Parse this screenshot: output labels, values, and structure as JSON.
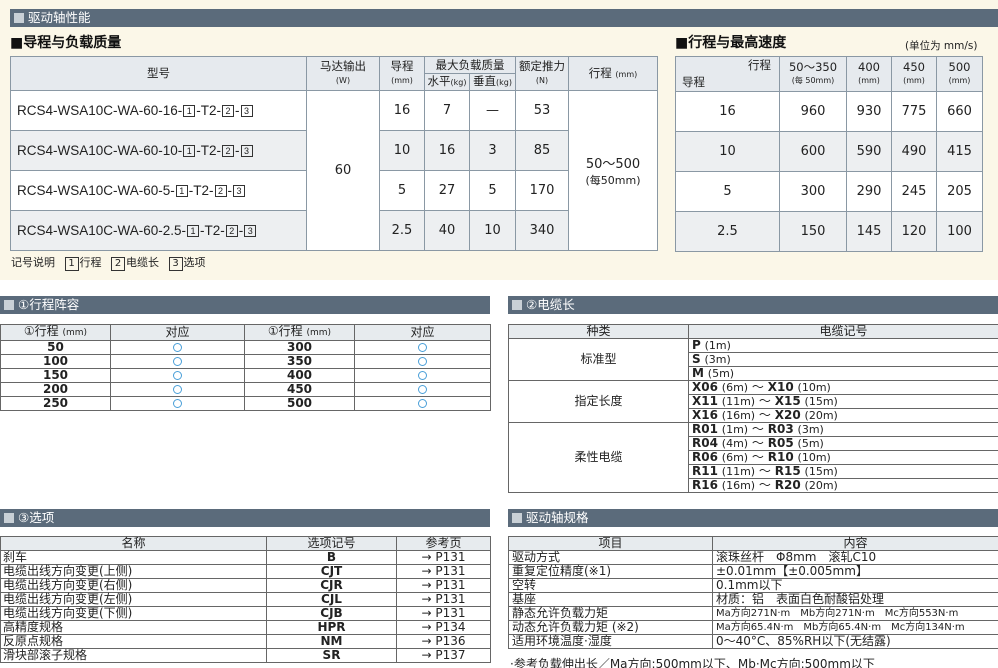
{
  "section_main": "驱动轴性能",
  "lead_load": {
    "heading": "■导程与负载质量",
    "headers": {
      "model": "型号",
      "motor": "马达输出",
      "motor_unit": "(W)",
      "lead": "导程",
      "lead_unit": "(mm)",
      "max_load": "最大负载质量",
      "horizontal": "水平",
      "horizontal_unit": "(kg)",
      "vertical": "垂直",
      "vertical_unit": "(kg)",
      "thrust": "额定推力",
      "thrust_unit": "(N)",
      "stroke": "行程",
      "stroke_unit": "(mm)"
    },
    "motor_value": "60",
    "stroke_value": "50～500",
    "stroke_step": "(每50mm)",
    "model_suffix": "-T2-",
    "model_sep": "-",
    "box1": "1",
    "box2": "2",
    "box3": "3",
    "rows": [
      {
        "model": "RCS4-WSA10C-WA-60-16-",
        "lead": "16",
        "horizontal": "7",
        "vertical": "—",
        "thrust": "53"
      },
      {
        "model": "RCS4-WSA10C-WA-60-10-",
        "lead": "10",
        "horizontal": "16",
        "vertical": "3",
        "thrust": "85"
      },
      {
        "model": "RCS4-WSA10C-WA-60-5-",
        "lead": "5",
        "horizontal": "27",
        "vertical": "5",
        "thrust": "170"
      },
      {
        "model": "RCS4-WSA10C-WA-60-2.5-",
        "lead": "2.5",
        "horizontal": "40",
        "vertical": "10",
        "thrust": "340"
      }
    ]
  },
  "speed": {
    "heading": "■行程与最高速度",
    "unit": "(单位为 mm/s)",
    "corner_top": "行程",
    "corner_bottom": "导程",
    "columns": [
      {
        "label": "50～350",
        "sub": "(每 50mm)"
      },
      {
        "label": "400",
        "sub": "(mm)"
      },
      {
        "label": "450",
        "sub": "(mm)"
      },
      {
        "label": "500",
        "sub": "(mm)"
      }
    ],
    "rows": [
      {
        "lead": "16",
        "values": [
          "960",
          "930",
          "775",
          "660"
        ]
      },
      {
        "lead": "10",
        "values": [
          "600",
          "590",
          "490",
          "415"
        ]
      },
      {
        "lead": "5",
        "values": [
          "300",
          "290",
          "245",
          "205"
        ]
      },
      {
        "lead": "2.5",
        "values": [
          "150",
          "145",
          "120",
          "100"
        ]
      }
    ]
  },
  "legend": {
    "label": "记号说明",
    "items": [
      {
        "box": "1",
        "text": "行程"
      },
      {
        "box": "2",
        "text": "电缆长"
      },
      {
        "box": "3",
        "text": "选项"
      }
    ]
  },
  "stroke_table": {
    "title": "①行程阵容",
    "headers": [
      "①行程",
      "(mm)",
      "对应",
      "①行程",
      "(mm)",
      "对应"
    ],
    "left": [
      "50",
      "100",
      "150",
      "200",
      "250"
    ],
    "right": [
      "300",
      "350",
      "400",
      "450",
      "500"
    ]
  },
  "cable_table": {
    "title": "②电缆长",
    "headers": [
      "种类",
      "电缆记号"
    ],
    "groups": [
      {
        "kind": "标准型",
        "lines": [
          {
            "code": "P",
            "len": "(1m)"
          },
          {
            "code": "S",
            "len": "(3m)"
          },
          {
            "code": "M",
            "len": "(5m)"
          }
        ]
      },
      {
        "kind": "指定长度",
        "lines": [
          {
            "code": "X06",
            "len": "(6m)",
            "code2": "X10",
            "len2": "(10m)"
          },
          {
            "code": "X11",
            "len": "(11m)",
            "code2": "X15",
            "len2": "(15m)"
          },
          {
            "code": "X16",
            "len": "(16m)",
            "code2": "X20",
            "len2": "(20m)"
          }
        ]
      },
      {
        "kind": "柔性电缆",
        "lines": [
          {
            "code": "R01",
            "len": "(1m)",
            "code2": "R03",
            "len2": "(3m)"
          },
          {
            "code": "R04",
            "len": "(4m)",
            "code2": "R05",
            "len2": "(5m)"
          },
          {
            "code": "R06",
            "len": "(6m)",
            "code2": "R10",
            "len2": "(10m)"
          },
          {
            "code": "R11",
            "len": "(11m)",
            "code2": "R15",
            "len2": "(15m)"
          },
          {
            "code": "R16",
            "len": "(16m)",
            "code2": "R20",
            "len2": "(20m)"
          }
        ]
      }
    ],
    "tilde": "～"
  },
  "option_table": {
    "title": "③选项",
    "headers": [
      "名称",
      "选项记号",
      "参考页"
    ],
    "rows": [
      {
        "name": "刹车",
        "code": "B",
        "page": "→ P131"
      },
      {
        "name": "电缆出线方向变更(上侧)",
        "code": "CJT",
        "page": "→ P131"
      },
      {
        "name": "电缆出线方向变更(右侧)",
        "code": "CJR",
        "page": "→ P131"
      },
      {
        "name": "电缆出线方向变更(左侧)",
        "code": "CJL",
        "page": "→ P131"
      },
      {
        "name": "电缆出线方向变更(下侧)",
        "code": "CJB",
        "page": "→ P131"
      },
      {
        "name": "高精度规格",
        "code": "HPR",
        "page": "→ P134"
      },
      {
        "name": "反原点规格",
        "code": "NM",
        "page": "→ P136"
      },
      {
        "name": "滑块部滚子规格",
        "code": "SR",
        "page": "→ P137"
      }
    ]
  },
  "drive_spec": {
    "title": "驱动轴规格",
    "headers": [
      "项目",
      "内容"
    ],
    "rows": [
      {
        "item": "驱动方式",
        "content": "滚珠丝杆　Φ8mm　滚轧C10"
      },
      {
        "item": "重复定位精度(※1)",
        "content": "±0.01mm【±0.005mm】"
      },
      {
        "item": "空转",
        "content": "0.1mm以下"
      },
      {
        "item": "基座",
        "content": "材质：铝　表面白色耐酸铝处理"
      },
      {
        "item": "静态允许负载力矩",
        "content": "Ma方向271N·m　Mb方向271N·m　Mc方向553N·m"
      },
      {
        "item": "动态允许负载力矩 (※2)",
        "content": "Ma方向65.4N·m　Mb方向65.4N·m　Mc方向134N·m"
      },
      {
        "item": "适用环境温度·湿度",
        "content": "0～40°C、85%RH以下(无结露)"
      }
    ],
    "note": "·参考负载伸出长／Ma方向:500mm以下、Mb·Mc方向:500mm以下"
  }
}
